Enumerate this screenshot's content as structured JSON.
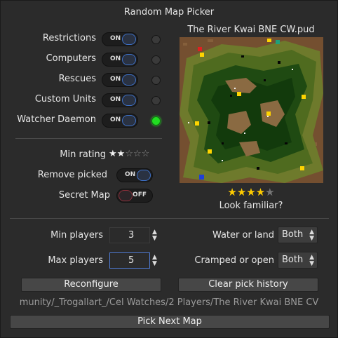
{
  "window": {
    "title": "Random Map Picker"
  },
  "switches": [
    {
      "label": "Restrictions",
      "state": "ON",
      "indicator": "off"
    },
    {
      "label": "Computers",
      "state": "ON",
      "indicator": "off"
    },
    {
      "label": "Rescues",
      "state": "ON",
      "indicator": "off"
    },
    {
      "label": "Custom Units",
      "state": "ON",
      "indicator": "off"
    },
    {
      "label": "Watcher Daemon",
      "state": "ON",
      "indicator": "on"
    }
  ],
  "filters": {
    "min_rating_label": "Min rating",
    "min_rating_value": 2,
    "min_rating_max": 5,
    "remove_picked_label": "Remove picked",
    "remove_picked_state": "ON",
    "secret_map_label": "Secret Map",
    "secret_map_state": "OFF"
  },
  "map": {
    "name": "The River Kwai BNE CW.pud",
    "rating": 4,
    "rating_max": 5,
    "prompt": "Look familiar?"
  },
  "players": {
    "min_label": "Min players",
    "min_value": "3",
    "max_label": "Max players",
    "max_value": "5"
  },
  "terrain": {
    "water_label": "Water or land",
    "water_value": "Both",
    "cramped_label": "Cramped or open",
    "cramped_value": "Both"
  },
  "buttons": {
    "reconfigure": "Reconfigure",
    "clear_history": "Clear pick history",
    "pick_next": "Pick Next Map"
  },
  "status": {
    "path": "munity/_Trogallart_/Cel Watches/2 Players/The River Kwai BNE CV"
  },
  "colors": {
    "background": "#2b2b2b",
    "accent_blue": "#3d70c6",
    "indicator_green": "#22dd22",
    "map_star": "#ffcc00"
  }
}
